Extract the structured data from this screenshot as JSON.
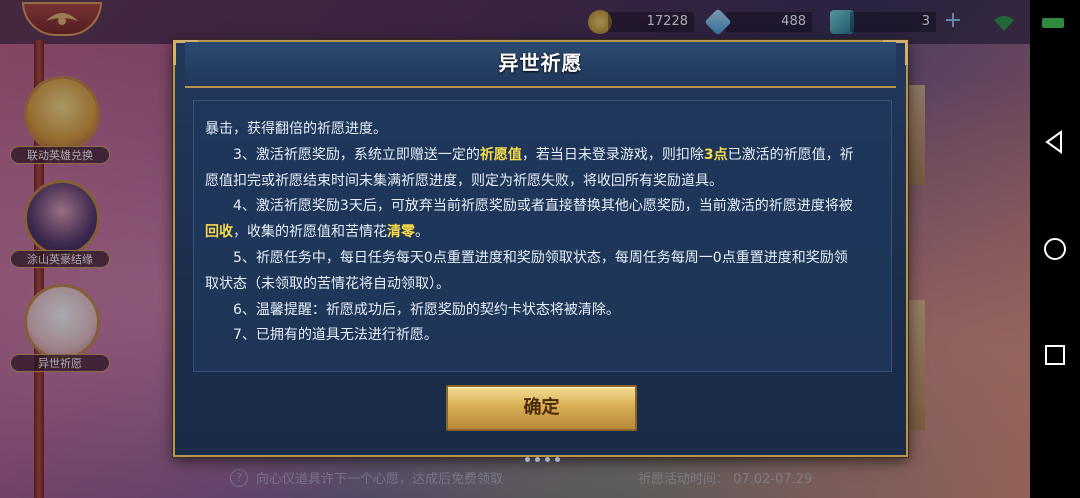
{
  "top_bar": {
    "gold_value": "17228",
    "diamond_value": "488",
    "gem_value": "3",
    "plus_label": "+"
  },
  "sidebar": {
    "items": [
      {
        "label": "联动英雄兑换"
      },
      {
        "label": "涂山英豪结缘"
      },
      {
        "label": "异世祈愿"
      }
    ]
  },
  "dialog": {
    "title": "异世祈愿",
    "confirm_label": "确定",
    "rules": {
      "p1": "暴击，获得翻倍的祈愿进度。",
      "p2_a": "　　3、激活祈愿奖励，系统立即赠送一定的",
      "p2_hl1": "祈愿值",
      "p2_b": "，若当日未登录游戏，则扣除",
      "p2_hl2": "3点",
      "p2_c": "已激活的祈愿值，祈愿值扣完或祈愿结束时间未集满祈愿进度，则定为祈愿失败，将收回所有奖励道具。",
      "p3_a": "　　4、激活祈愿奖励3天后，可放弃当前祈愿奖励或者直接替换其他心愿奖励，当前激活的祈愿进度将被",
      "p3_hl1": "回收",
      "p3_b": "，收集的祈愿值和苦情花",
      "p3_hl2": "清零",
      "p3_c": "。",
      "p4": "　　5、祈愿任务中，每日任务每天0点重置进度和奖励领取状态，每周任务每周一0点重置进度和奖励领取状态（未领取的苦情花将自动领取）。",
      "p5": "　　6、温馨提醒：祈愿成功后，祈愿奖励的契约卡状态将被清除。",
      "p6": "　　7、已拥有的道具无法进行祈愿。"
    }
  },
  "footer": {
    "tip": "向心仪道具许下一个心愿，达成后免费领取",
    "time_label": "祈愿活动时间：",
    "time_value": "07.02-07.29"
  },
  "colors": {
    "accent_gold": "#b8944f",
    "highlight_yellow": "#f5d94a",
    "dialog_bg": "#1b2e4c"
  },
  "icons": [
    "home-emblem-icon",
    "gold-coin-icon",
    "diamond-icon",
    "gem-icon",
    "plus-icon",
    "wifi-icon",
    "battery-icon",
    "back-icon",
    "home-icon",
    "recents-icon",
    "question-icon"
  ]
}
